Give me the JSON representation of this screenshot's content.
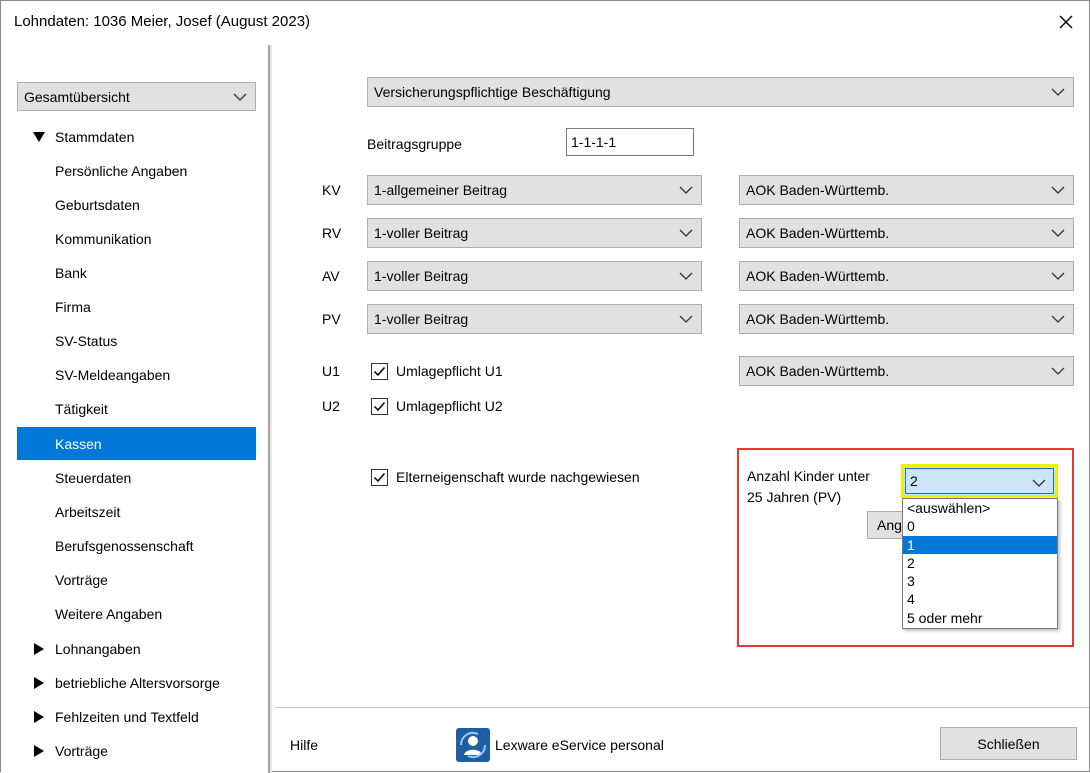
{
  "window": {
    "title": "Lohndaten: 1036  Meier, Josef (August 2023)"
  },
  "nav": {
    "combo_value": "Gesamtübersicht",
    "items": [
      {
        "label": "Stammdaten",
        "type": "group-expanded"
      },
      {
        "label": "Persönliche Angaben",
        "type": "item"
      },
      {
        "label": "Geburtsdaten",
        "type": "item"
      },
      {
        "label": "Kommunikation",
        "type": "item"
      },
      {
        "label": "Bank",
        "type": "item"
      },
      {
        "label": "Firma",
        "type": "item"
      },
      {
        "label": "SV-Status",
        "type": "item"
      },
      {
        "label": "SV-Meldeangaben",
        "type": "item"
      },
      {
        "label": "Tätigkeit",
        "type": "item"
      },
      {
        "label": "Kassen",
        "type": "item-selected"
      },
      {
        "label": "Steuerdaten",
        "type": "item"
      },
      {
        "label": "Arbeitszeit",
        "type": "item"
      },
      {
        "label": "Berufsgenossenschaft",
        "type": "item"
      },
      {
        "label": "Vorträge",
        "type": "item"
      },
      {
        "label": "Weitere Angaben",
        "type": "item"
      },
      {
        "label": "Lohnangaben",
        "type": "group-collapsed"
      },
      {
        "label": "betriebliche Altersvorsorge",
        "type": "group-collapsed"
      },
      {
        "label": "Fehlzeiten und Textfeld",
        "type": "group-collapsed"
      },
      {
        "label": "Vorträge",
        "type": "group-collapsed"
      }
    ]
  },
  "main": {
    "employment_type": "Versicherungspflichtige Beschäftigung",
    "beitragsgruppe_label": "Beitragsgruppe",
    "beitragsgruppe_value": "1-1-1-1",
    "rows": [
      {
        "code": "KV",
        "contribution": "1-allgemeiner Beitrag",
        "kasse": "AOK Baden-Württemb."
      },
      {
        "code": "RV",
        "contribution": "1-voller Beitrag",
        "kasse": "AOK Baden-Württemb."
      },
      {
        "code": "AV",
        "contribution": "1-voller Beitrag",
        "kasse": "AOK Baden-Württemb."
      },
      {
        "code": "PV",
        "contribution": "1-voller Beitrag",
        "kasse": "AOK Baden-Württemb."
      }
    ],
    "u1": {
      "code": "U1",
      "label": "Umlagepflicht U1",
      "checked": true,
      "kasse": "AOK Baden-Württemb."
    },
    "u2": {
      "code": "U2",
      "label": "Umlagepflicht U2",
      "checked": true
    },
    "eltern": {
      "label": "Elterneigenschaft wurde nachgewiesen",
      "checked": true
    },
    "kinder": {
      "label_line1": "Anzahl Kinder unter",
      "label_line2": "25 Jahren (PV)",
      "value": "2",
      "options": [
        "<auswählen>",
        "0",
        "1",
        "2",
        "3",
        "4",
        "5 oder mehr"
      ],
      "highlighted_option": "1",
      "hidden_button_label": "Ang"
    }
  },
  "footer": {
    "help_label": "Hilfe",
    "eservice_label": "Lexware eService personal",
    "close_label": "Schließen"
  },
  "colors": {
    "selection": "#0078d7",
    "highlight_border": "#e53935",
    "focus_border": "#f2ef00"
  }
}
